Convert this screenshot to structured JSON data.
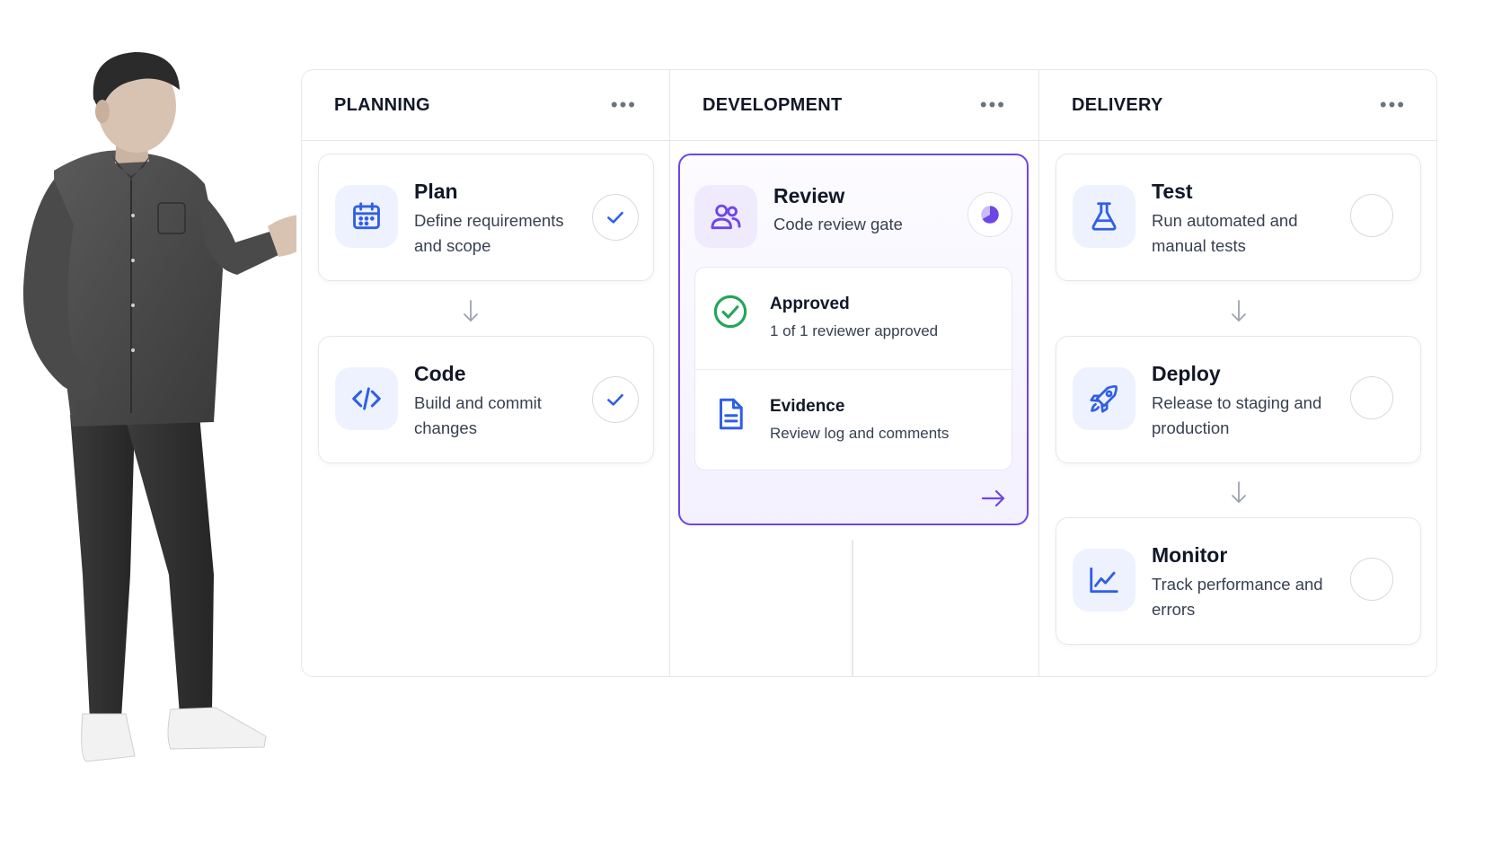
{
  "columns": {
    "planning": {
      "title": "PLANNING",
      "menu_icon": "more-horizontal-icon"
    },
    "development": {
      "title": "DEVELOPMENT",
      "menu_icon": "more-horizontal-icon"
    },
    "delivery": {
      "title": "DELIVERY",
      "menu_icon": "more-horizontal-icon"
    }
  },
  "planning": {
    "plan": {
      "title": "Plan",
      "description": "Define requirements and scope",
      "icon": "calendar-icon",
      "status": "complete"
    },
    "code": {
      "title": "Code",
      "description": "Build and commit changes",
      "icon": "code-icon",
      "status": "complete"
    }
  },
  "development": {
    "review": {
      "title": "Review",
      "description": "Code review gate",
      "icon": "users-icon",
      "status": "in-progress",
      "approved": {
        "title": "Approved",
        "description": "1 of 1 reviewer approved",
        "icon": "check-circle-icon"
      },
      "evidence": {
        "title": "Evidence",
        "description": "Review log and comments",
        "icon": "file-icon"
      }
    }
  },
  "delivery": {
    "test": {
      "title": "Test",
      "description": "Run automated and manual tests",
      "icon": "flask-icon",
      "status": "pending"
    },
    "deploy": {
      "title": "Deploy",
      "description": "Release to staging and production",
      "icon": "rocket-icon",
      "status": "pending"
    },
    "monitor": {
      "title": "Monitor",
      "description": "Track performance and errors",
      "icon": "chart-line-icon",
      "status": "pending"
    }
  },
  "colors": {
    "accent_blue": "#2f5fe8",
    "accent_purple": "#6d46e8",
    "success_green": "#22a65a",
    "border": "#e6e7eb"
  }
}
